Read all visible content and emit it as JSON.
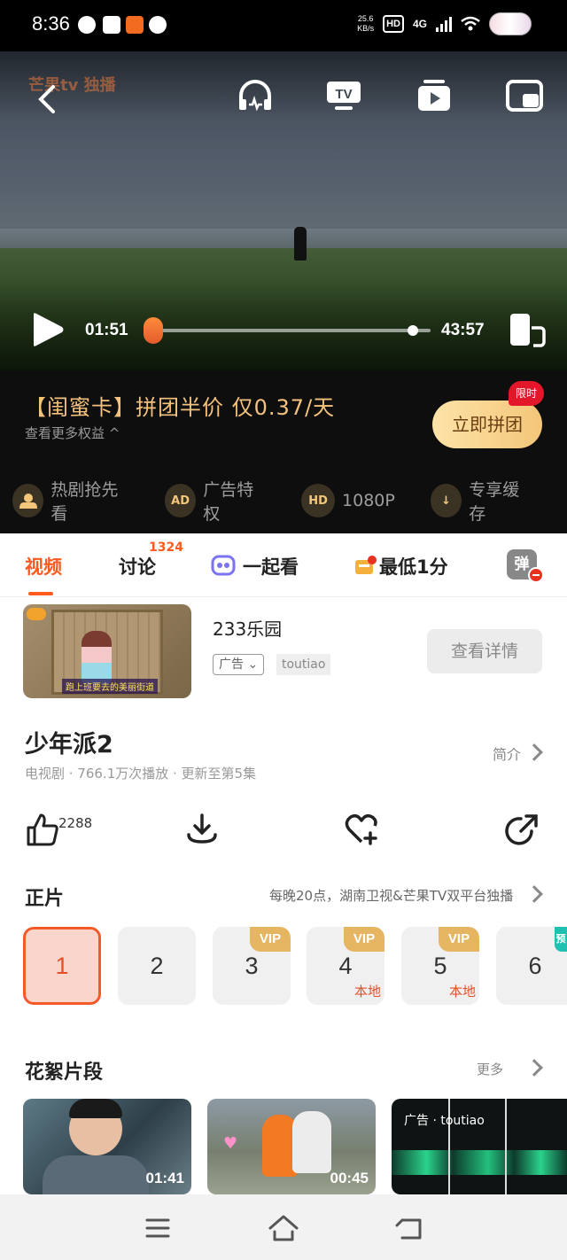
{
  "status_bar": {
    "time": "8:36",
    "speed": "25.6",
    "speed_unit": "KB/s",
    "hd": "HD",
    "network": "4G"
  },
  "player": {
    "watermark": "芒果tv 独播",
    "current_time": "01:51",
    "total_time": "43:57",
    "progress": 0.042
  },
  "vip": {
    "title": "【闺蜜卡】拼团半价 仅0.37/天",
    "subtitle": "查看更多权益 ^",
    "cta": "立即拼团",
    "tag": "限时",
    "perks": [
      {
        "icon": "hot-drama-icon",
        "label": "热剧抢先看"
      },
      {
        "icon": "ad-privilege-icon",
        "glyph": "AD",
        "label": "广告特权"
      },
      {
        "icon": "hd-icon",
        "glyph": "HD",
        "label": "1080P"
      },
      {
        "icon": "download-cache-icon",
        "glyph": "↓",
        "label": "专享缓存"
      }
    ]
  },
  "tabs": {
    "video": "视频",
    "discuss": "讨论",
    "discuss_count": "1324",
    "watch_together": "一起看",
    "lowest": "最低1分",
    "danmu": "弹"
  },
  "ad": {
    "title": "233乐园",
    "tag": "广告",
    "source": "toutiao",
    "button": "查看详情",
    "thumb_caption": "跑上班要去的美丽街道"
  },
  "show": {
    "title": "少年派2",
    "meta": "电视剧 · 766.1万次播放 · 更新至第5集",
    "intro": "简介"
  },
  "actions": {
    "like_count": "2288"
  },
  "episodes": {
    "title": "正片",
    "note": "每晚20点，湖南卫视&芒果TV双平台独播",
    "items": [
      {
        "num": "1",
        "vip": "",
        "local": ""
      },
      {
        "num": "2",
        "vip": "",
        "local": ""
      },
      {
        "num": "3",
        "vip": "VIP",
        "local": ""
      },
      {
        "num": "4",
        "vip": "VIP",
        "local": "本地"
      },
      {
        "num": "5",
        "vip": "VIP",
        "local": "本地"
      },
      {
        "num": "6",
        "vip": "预",
        "local": ""
      }
    ]
  },
  "clips": {
    "title": "花絮片段",
    "more": "更多",
    "items": [
      {
        "duration": "01:41"
      },
      {
        "duration": "00:45"
      },
      {
        "ad_label": "广告 · toutiao"
      }
    ]
  },
  "colors": {
    "accent": "#ff5a1f",
    "vip_gold": "#f3c679",
    "vip_badge": "#e6b561"
  }
}
